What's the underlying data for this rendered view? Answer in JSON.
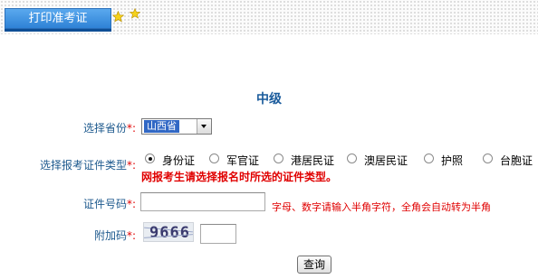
{
  "header": {
    "tab_label": "打印准考证",
    "stars": [
      "star-icon",
      "star-icon"
    ]
  },
  "form": {
    "title": "中级",
    "province_label": "选择省份",
    "required_mark": "*:",
    "province_value": "山西省",
    "id_type_label": "选择报考证件类型",
    "id_types": [
      "身份证",
      "军官证",
      "港居民证",
      "澳居民证",
      "护照",
      "台胞证"
    ],
    "id_type_selected": "身份证",
    "id_type_warning": "网报考生请选择报名时所选的证件类型。",
    "id_number_label": "证件号码",
    "id_number_value": "",
    "id_number_hint": "字母、数字请输入半角字符，全角会自动转为半角",
    "captcha_label": "附加码",
    "captcha_image_text": "9666",
    "captcha_value": "",
    "submit_label": "查询"
  },
  "colors": {
    "tab_blue": "#3b8ee0",
    "label_blue": "#1e5a8e",
    "title_blue": "#1a5b9c",
    "warning_red": "#e00000",
    "star_yellow": "#f5d21b"
  }
}
